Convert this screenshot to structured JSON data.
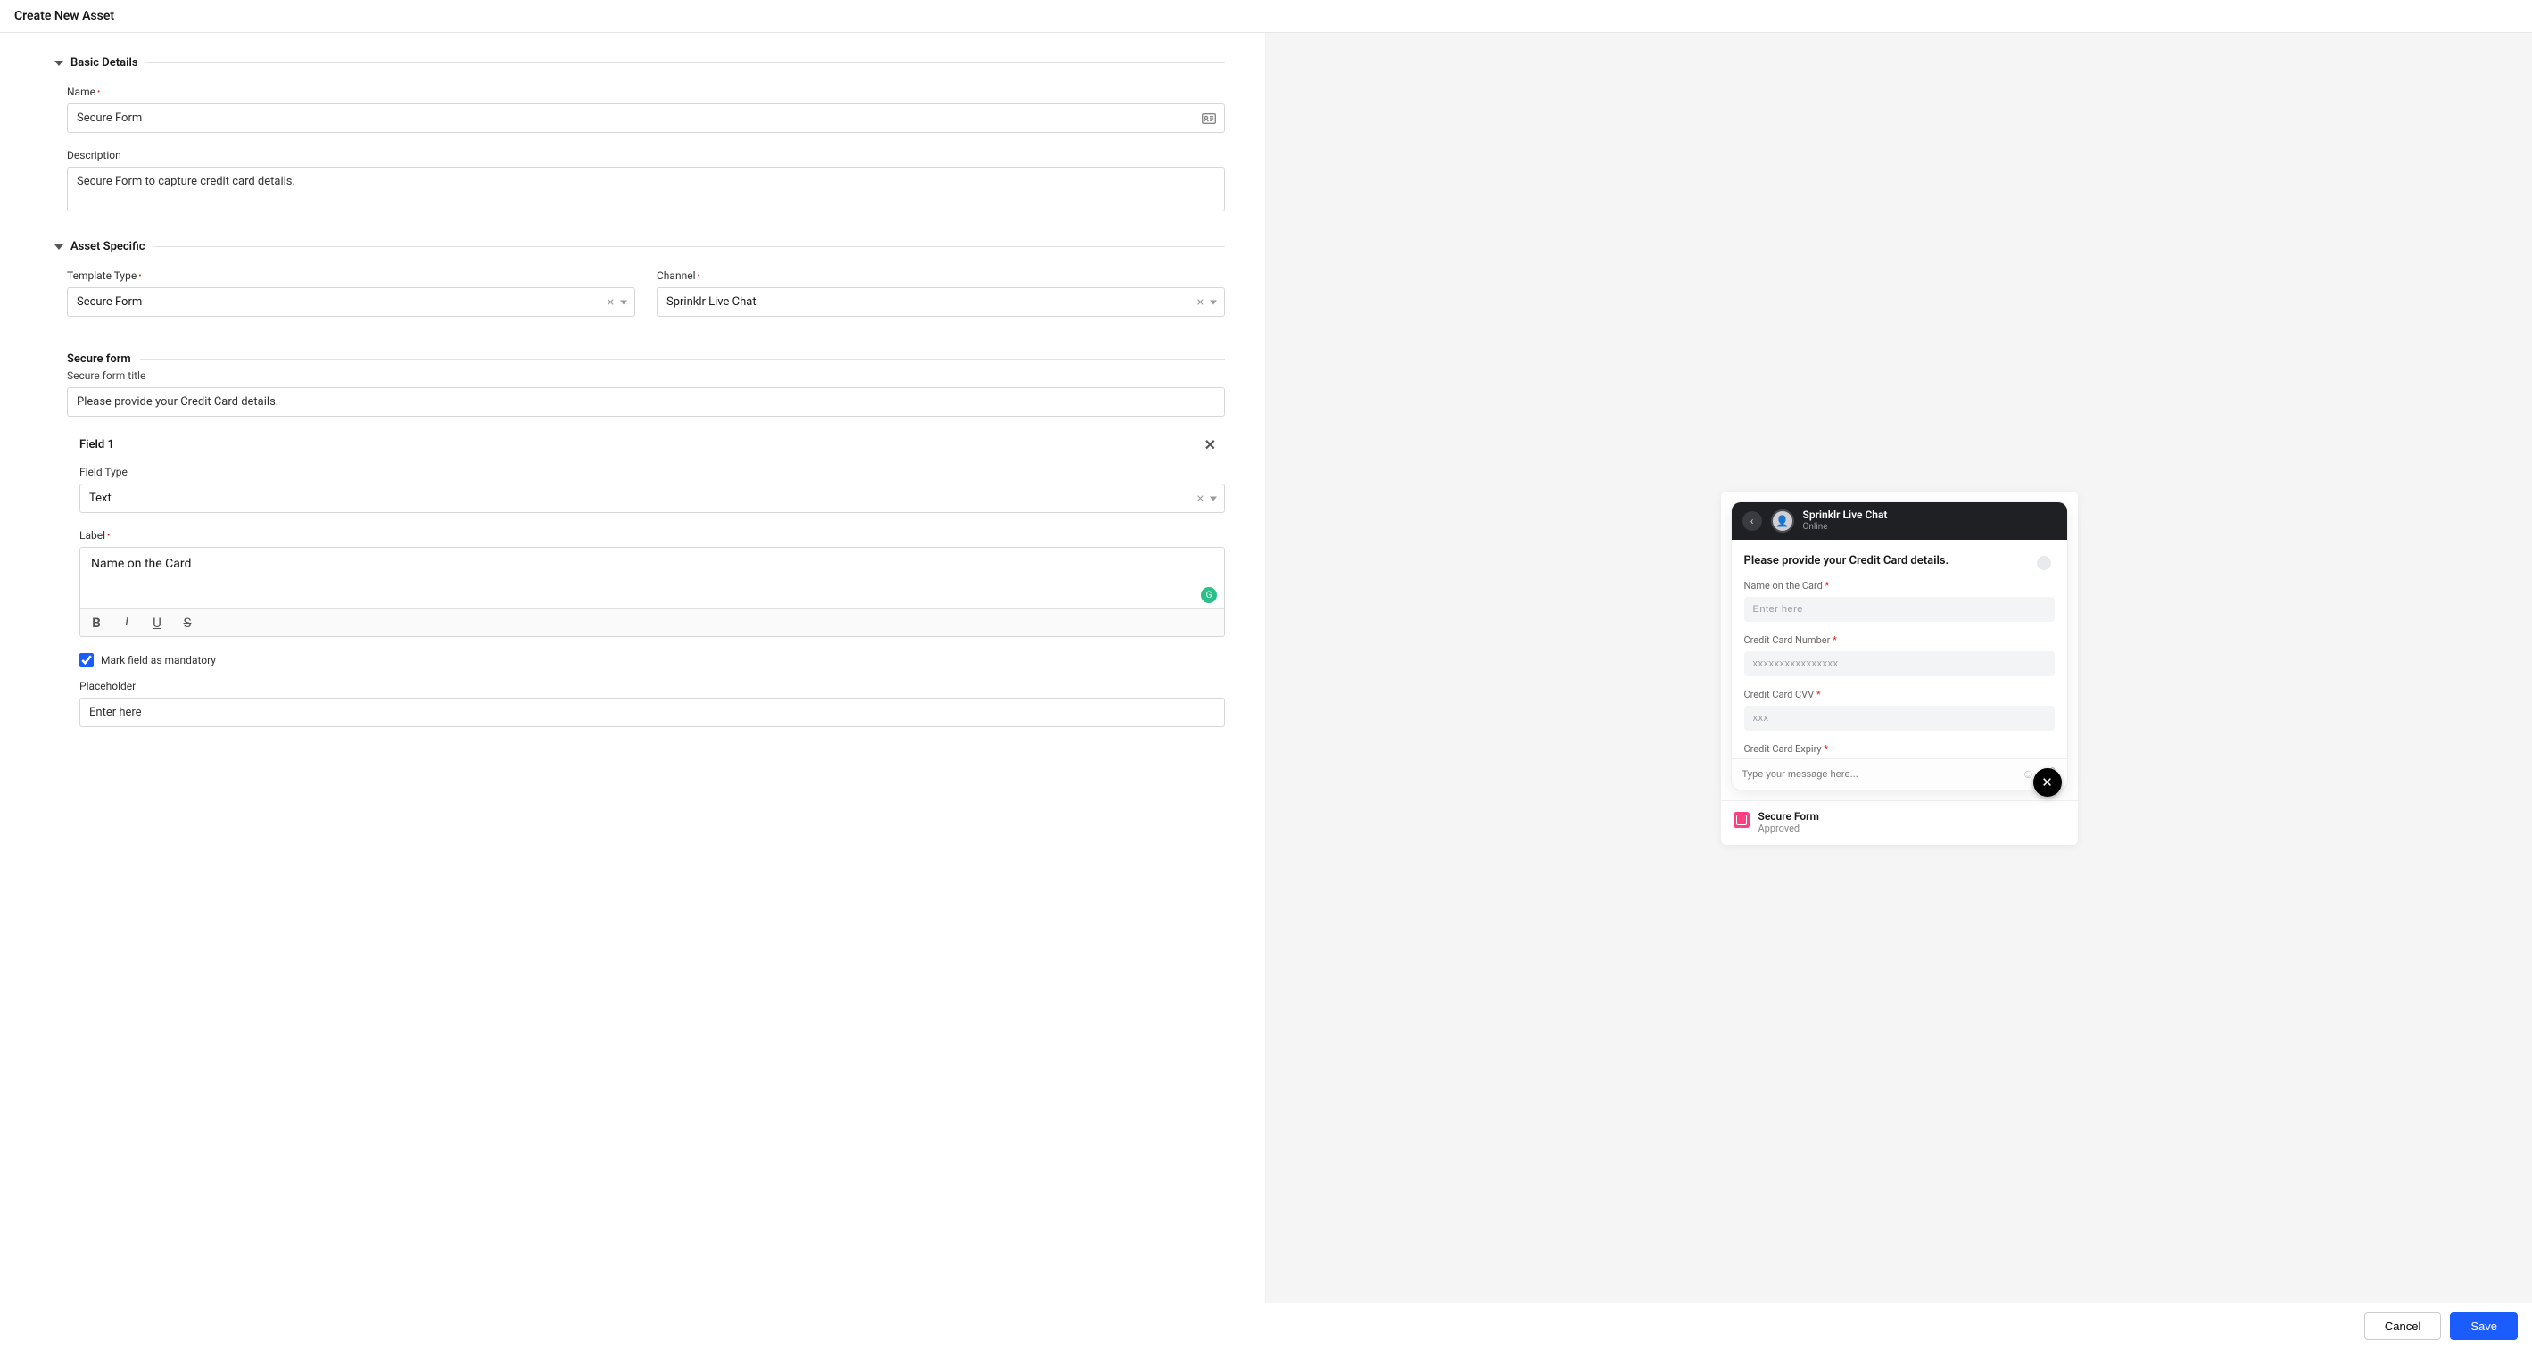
{
  "header": {
    "title": "Create New Asset"
  },
  "sections": {
    "basic": {
      "title": "Basic Details",
      "name_label": "Name",
      "name_value": "Secure Form",
      "desc_label": "Description",
      "desc_value": "Secure Form to capture credit card details."
    },
    "assetSpecific": {
      "title": "Asset Specific",
      "template_label": "Template Type",
      "template_value": "Secure Form",
      "channel_label": "Channel",
      "channel_value": "Sprinklr Live Chat"
    },
    "secureForm": {
      "title": "Secure form",
      "title_label": "Secure form title",
      "title_value": "Please provide your Credit Card details."
    },
    "field1": {
      "heading": "Field 1",
      "type_label": "Field Type",
      "type_value": "Text",
      "label_label": "Label",
      "label_value": "Name on the Card",
      "mandatory_label": "Mark field as mandatory",
      "mandatory_checked": true,
      "placeholder_label": "Placeholder",
      "placeholder_value": "Enter here"
    }
  },
  "preview": {
    "chat": {
      "title": "Sprinklr Live Chat",
      "status": "Online",
      "form_title": "Please provide your Credit Card details.",
      "fields": {
        "f1": {
          "label": "Name on the Card",
          "placeholder": "Enter here",
          "required": true
        },
        "f2": {
          "label": "Credit Card Number",
          "placeholder": "xxxxxxxxxxxxxxxx",
          "required": true
        },
        "f3": {
          "label": "Credit Card CVV",
          "placeholder": "xxx",
          "required": true
        },
        "f4": {
          "label": "Credit Card Expiry",
          "required": true
        }
      },
      "msg_placeholder": "Type your message here..."
    },
    "footer": {
      "name": "Secure Form",
      "status": "Approved"
    }
  },
  "footer": {
    "cancel": "Cancel",
    "save": "Save"
  }
}
